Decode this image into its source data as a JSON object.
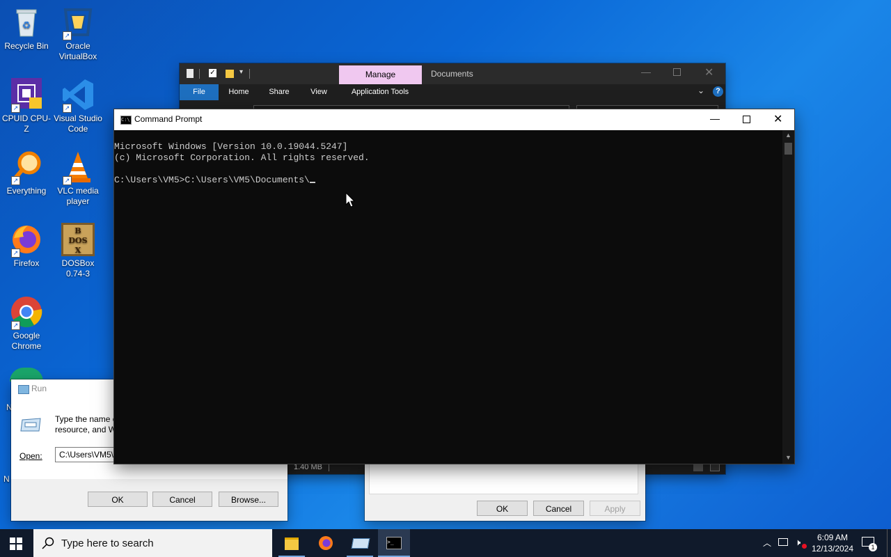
{
  "desktop": {
    "icons": [
      {
        "label": "Recycle Bin"
      },
      {
        "label": "Oracle VirtualBox"
      },
      {
        "label": "CPUID CPU-Z"
      },
      {
        "label": "Visual Studio Code"
      },
      {
        "label": "Everything"
      },
      {
        "label": "VLC media player"
      },
      {
        "label": "Firefox"
      },
      {
        "label": "DOSBox 0.74-3"
      },
      {
        "label": "Google Chrome"
      }
    ],
    "partial_labels": [
      "N",
      "N"
    ]
  },
  "explorer": {
    "contextual_tab": "Manage",
    "title": "Documents",
    "ribbon": {
      "file": "File",
      "home": "Home",
      "share": "Share",
      "view": "View",
      "app_tools": "Application Tools"
    },
    "status_size": "1.40 MB"
  },
  "cmd": {
    "title": "Command Prompt",
    "lines": [
      "Microsoft Windows [Version 10.0.19044.5247]",
      "(c) Microsoft Corporation. All rights reserved.",
      "",
      "C:\\Users\\VM5>C:\\Users\\VM5\\Documents\\"
    ]
  },
  "run": {
    "title": "Run",
    "description": "Type the name of a program, folder, document, or Internet resource, and Windows will open it for you.",
    "desc_line1": "Type the name o",
    "desc_line2": "resource, and W",
    "open_label": "Open:",
    "open_value": "C:\\Users\\VM5\\",
    "ok": "OK",
    "cancel": "Cancel",
    "browse": "Browse..."
  },
  "properties": {
    "ok": "OK",
    "cancel": "Cancel",
    "apply": "Apply"
  },
  "taskbar": {
    "search_placeholder": "Type here to search",
    "time": "6:09 AM",
    "date": "12/13/2024",
    "notification_count": "1"
  },
  "colors": {
    "desktop_blue": "#0a67d6",
    "taskbar": "#101a2b",
    "manage_tab": "#f0c8f0",
    "ribbon_file": "#1e6fbf"
  }
}
